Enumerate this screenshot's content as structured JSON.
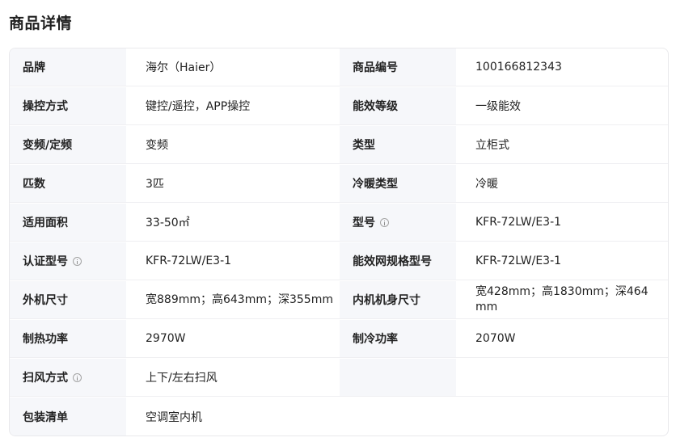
{
  "section_title": "商品详情",
  "rows": [
    {
      "k1": "品牌",
      "v1": "海尔（Haier）",
      "k2": "商品编号",
      "v2": "100166812343"
    },
    {
      "k1": "操控方式",
      "v1": "键控/遥控，APP操控",
      "k2": "能效等级",
      "v2": "一级能效"
    },
    {
      "k1": "变频/定频",
      "v1": "变频",
      "k2": "类型",
      "v2": "立柜式"
    },
    {
      "k1": "匹数",
      "v1": "3匹",
      "k2": "冷暖类型",
      "v2": "冷暖"
    },
    {
      "k1": "适用面积",
      "v1": "33-50㎡",
      "k2": "型号",
      "v2": "KFR-72LW/E3-1"
    },
    {
      "k1": "认证型号",
      "v1": "KFR-72LW/E3-1",
      "k2": "能效网规格型号",
      "v2": "KFR-72LW/E3-1"
    },
    {
      "k1": "外机尺寸",
      "v1": "宽889mm；高643mm；深355mm",
      "k2": "内机机身尺寸",
      "v2": "宽428mm；高1830mm；深464mm"
    },
    {
      "k1": "制热功率",
      "v1": "2970W",
      "k2": "制冷功率",
      "v2": "2070W"
    },
    {
      "k1": "扫风方式",
      "v1": "上下/左右扫风"
    },
    {
      "k1": "包装清单",
      "v1": "空调室内机"
    }
  ],
  "icons": {
    "info": "info-circle-icon"
  }
}
